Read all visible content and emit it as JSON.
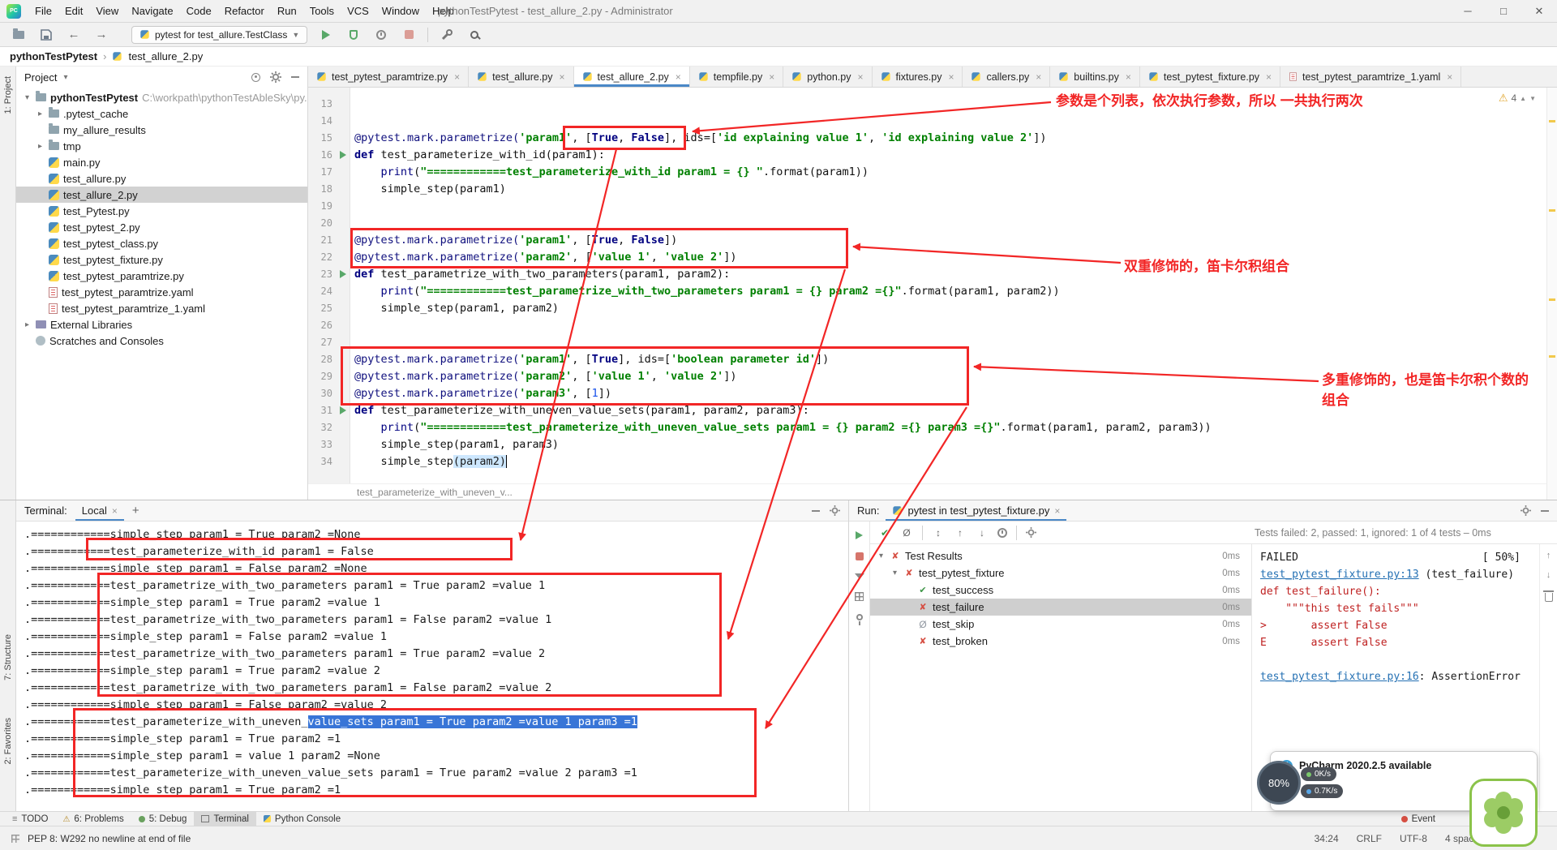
{
  "titlebar": {
    "menus": [
      "File",
      "Edit",
      "View",
      "Navigate",
      "Code",
      "Refactor",
      "Run",
      "Tools",
      "VCS",
      "Window",
      "Help"
    ],
    "title": "pythonTestPytest - test_allure_2.py - Administrator",
    "logo": "PC"
  },
  "toolbar": {
    "run_config": "pytest for test_allure.TestClass"
  },
  "breadcrumb": {
    "root": "pythonTestPytest",
    "file": "test_allure_2.py"
  },
  "stripes": {
    "project": "1: Project",
    "structure": "7: Structure",
    "favorites": "2: Favorites"
  },
  "project": {
    "header": "Project",
    "tree": [
      {
        "indent": 0,
        "chevron": "▾",
        "icon": "folder",
        "label": "pythonTestPytest",
        "path": "C:\\workpath\\pythonTestAbleSky\\py...",
        "bold": true
      },
      {
        "indent": 1,
        "chevron": "▸",
        "icon": "folder",
        "label": ".pytest_cache"
      },
      {
        "indent": 1,
        "icon": "folder",
        "label": "my_allure_results"
      },
      {
        "indent": 1,
        "chevron": "▸",
        "icon": "folder",
        "label": "tmp"
      },
      {
        "indent": 1,
        "icon": "py",
        "label": "main.py"
      },
      {
        "indent": 1,
        "icon": "py",
        "label": "test_allure.py"
      },
      {
        "indent": 1,
        "icon": "py",
        "label": "test_allure_2.py",
        "selected": true
      },
      {
        "indent": 1,
        "icon": "py",
        "label": "test_Pytest.py"
      },
      {
        "indent": 1,
        "icon": "py",
        "label": "test_pytest_2.py"
      },
      {
        "indent": 1,
        "icon": "py",
        "label": "test_pytest_class.py"
      },
      {
        "indent": 1,
        "icon": "py",
        "label": "test_pytest_fixture.py"
      },
      {
        "indent": 1,
        "icon": "py",
        "label": "test_pytest_paramtrize.py"
      },
      {
        "indent": 1,
        "icon": "yaml",
        "label": "test_pytest_paramtrize.yaml"
      },
      {
        "indent": 1,
        "icon": "yaml",
        "label": "test_pytest_paramtrize_1.yaml"
      },
      {
        "indent": 0,
        "chevron": "▸",
        "icon": "lib",
        "label": "External Libraries"
      },
      {
        "indent": 0,
        "icon": "scratch",
        "label": "Scratches and Consoles"
      }
    ]
  },
  "editor": {
    "tabs": [
      {
        "label": "test_pytest_paramtrize.py",
        "icon": "py"
      },
      {
        "label": "test_allure.py",
        "icon": "py"
      },
      {
        "label": "test_allure_2.py",
        "icon": "py",
        "active": true
      },
      {
        "label": "tempfile.py",
        "icon": "py"
      },
      {
        "label": "python.py",
        "icon": "py"
      },
      {
        "label": "fixtures.py",
        "icon": "py"
      },
      {
        "label": "callers.py",
        "icon": "py"
      },
      {
        "label": "builtins.py",
        "icon": "py"
      },
      {
        "label": "test_pytest_fixture.py",
        "icon": "py"
      },
      {
        "label": "test_pytest_paramtrize_1.yaml",
        "icon": "yaml"
      }
    ],
    "inspection": {
      "warnings": "4"
    },
    "context_hint": "test_parameterize_with_uneven_v...",
    "code": {
      "lines": [
        {
          "n": 13,
          "seg": []
        },
        {
          "n": 14,
          "seg": []
        },
        {
          "n": 15,
          "seg": [
            [
              "d",
              "@pytest.mark.parametrize("
            ],
            [
              "s",
              "'param1'"
            ],
            [
              "t",
              ", ["
            ],
            [
              "k",
              "True"
            ],
            [
              "t",
              ", "
            ],
            [
              "k",
              "False"
            ],
            [
              "t",
              "], ids=["
            ],
            [
              "s",
              "'id explaining value 1'"
            ],
            [
              "t",
              ", "
            ],
            [
              "s",
              "'id explaining value 2'"
            ],
            [
              "t",
              "])"
            ]
          ]
        },
        {
          "n": 16,
          "run": true,
          "seg": [
            [
              "k",
              "def "
            ],
            [
              "t",
              "test_parameterize_with_id(param1):"
            ]
          ]
        },
        {
          "n": 17,
          "seg": [
            [
              "t",
              "    "
            ],
            [
              "k2",
              "print"
            ],
            [
              "t",
              "("
            ],
            [
              "s",
              "\"============test_parameterize_with_id param1 = {} \""
            ],
            [
              "t",
              ".format(param1))"
            ]
          ]
        },
        {
          "n": 18,
          "seg": [
            [
              "t",
              "    simple_step(param1)"
            ]
          ]
        },
        {
          "n": 19,
          "seg": []
        },
        {
          "n": 20,
          "seg": []
        },
        {
          "n": 21,
          "seg": [
            [
              "d",
              "@pytest.mark.parametrize("
            ],
            [
              "s",
              "'param1'"
            ],
            [
              "t",
              ", ["
            ],
            [
              "k",
              "True"
            ],
            [
              "t",
              ", "
            ],
            [
              "k",
              "False"
            ],
            [
              "t",
              "])"
            ]
          ]
        },
        {
          "n": 22,
          "seg": [
            [
              "d",
              "@pytest.mark.parametrize("
            ],
            [
              "s",
              "'param2'"
            ],
            [
              "t",
              ", ["
            ],
            [
              "s",
              "'value 1'"
            ],
            [
              "t",
              ", "
            ],
            [
              "s",
              "'value 2'"
            ],
            [
              "t",
              "])"
            ]
          ]
        },
        {
          "n": 23,
          "run": true,
          "seg": [
            [
              "k",
              "def "
            ],
            [
              "t",
              "test_parametrize_with_two_parameters(param1, param2):"
            ]
          ]
        },
        {
          "n": 24,
          "seg": [
            [
              "t",
              "    "
            ],
            [
              "k2",
              "print"
            ],
            [
              "t",
              "("
            ],
            [
              "s",
              "\"============test_parametrize_with_two_parameters param1 = {} param2 ={}\""
            ],
            [
              "t",
              ".format(param1, param2))"
            ]
          ]
        },
        {
          "n": 25,
          "seg": [
            [
              "t",
              "    simple_step(param1, param2)"
            ]
          ]
        },
        {
          "n": 26,
          "seg": []
        },
        {
          "n": 27,
          "seg": []
        },
        {
          "n": 28,
          "seg": [
            [
              "d",
              "@pytest.mark.parametrize("
            ],
            [
              "s",
              "'param1'"
            ],
            [
              "t",
              ", ["
            ],
            [
              "k",
              "True"
            ],
            [
              "t",
              "], ids=["
            ],
            [
              "s",
              "'boolean parameter id'"
            ],
            [
              "t",
              "])"
            ]
          ]
        },
        {
          "n": 29,
          "seg": [
            [
              "d",
              "@pytest.mark.parametrize("
            ],
            [
              "s",
              "'param2'"
            ],
            [
              "t",
              ", ["
            ],
            [
              "s",
              "'value 1'"
            ],
            [
              "t",
              ", "
            ],
            [
              "s",
              "'value 2'"
            ],
            [
              "t",
              "])"
            ]
          ]
        },
        {
          "n": 30,
          "seg": [
            [
              "d",
              "@pytest.mark.parametrize("
            ],
            [
              "s",
              "'param3'"
            ],
            [
              "t",
              ", ["
            ],
            [
              "num",
              "1"
            ],
            [
              "t",
              "])"
            ]
          ]
        },
        {
          "n": 31,
          "run": true,
          "seg": [
            [
              "k",
              "def "
            ],
            [
              "t",
              "test_parameterize_with_uneven_value_sets(param1, param2, param3):"
            ]
          ]
        },
        {
          "n": 32,
          "seg": [
            [
              "t",
              "    "
            ],
            [
              "k2",
              "print"
            ],
            [
              "t",
              "("
            ],
            [
              "s",
              "\"============test_parameterize_with_uneven_value_sets param1 = {} param2 ={} param3 ={}\""
            ],
            [
              "t",
              ".format(param1, param2, param3))"
            ]
          ]
        },
        {
          "n": 33,
          "seg": [
            [
              "t",
              "    simple_step(param1, param3)"
            ]
          ]
        },
        {
          "n": 34,
          "caret": true,
          "seg": [
            [
              "t",
              "    simple_step"
            ],
            [
              "hl",
              "(param2)"
            ]
          ]
        }
      ]
    }
  },
  "terminal": {
    "title": "Terminal:",
    "tab": "Local",
    "lines": [
      {
        "t": ".============simple_step param1 = True param2 =None"
      },
      {
        "t": ".============test_parameterize_with_id param1 = False"
      },
      {
        "t": ".============simple_step param1 = False param2 =None"
      },
      {
        "t": ".============test_parametrize_with_two_parameters param1 = True param2 =value 1"
      },
      {
        "t": ".============simple_step param1 = True param2 =value 1"
      },
      {
        "t": ".============test_parametrize_with_two_parameters param1 = False param2 =value 1"
      },
      {
        "t": ".============simple_step param1 = False param2 =value 1"
      },
      {
        "t": ".============test_parametrize_with_two_parameters param1 = True param2 =value 2"
      },
      {
        "t": ".============simple_step param1 = True param2 =value 2"
      },
      {
        "t": ".============test_parametrize_with_two_parameters param1 = False param2 =value 2"
      },
      {
        "t": ".============simple_step param1 = False param2 =value 2"
      },
      {
        "pre": ".============test_parameterize_with_uneven_",
        "sel": "value_sets param1 = True param2 =value 1 param3 =1"
      },
      {
        "t": ".============simple_step param1 = True param2 =1"
      },
      {
        "t": ".============simple_step param1 = value 1 param2 =None"
      },
      {
        "t": ".============test_parameterize_with_uneven_value_sets param1 = True param2 =value 2 param3 =1"
      },
      {
        "t": ".============simple_step param1 = True param2 =1"
      }
    ]
  },
  "run": {
    "label": "Run:",
    "tab": "pytest in test_pytest_fixture.py",
    "stats": "Tests failed: 2, passed: 1, ignored: 1 of 4 tests – 0ms",
    "tree": [
      {
        "indent": 0,
        "chevron": "▾",
        "icon": "fail",
        "label": "Test Results",
        "time": "0ms"
      },
      {
        "indent": 1,
        "chevron": "▾",
        "icon": "fail",
        "label": "test_pytest_fixture",
        "time": "0ms"
      },
      {
        "indent": 2,
        "icon": "pass",
        "label": "test_success",
        "time": "0ms"
      },
      {
        "indent": 2,
        "icon": "fail",
        "label": "test_failure",
        "time": "0ms",
        "selected": true
      },
      {
        "indent": 2,
        "icon": "skip",
        "label": "test_skip",
        "time": "0ms"
      },
      {
        "indent": 2,
        "icon": "fail",
        "label": "test_broken",
        "time": "0ms"
      }
    ],
    "console": [
      {
        "cls": "plain",
        "t": "FAILED                             [ 50%]"
      },
      {
        "cls": "plain",
        "link": "test_pytest_fixture.py:13",
        "rest": " (test_failure)"
      },
      {
        "cls": "err",
        "t": "def test_failure():"
      },
      {
        "cls": "err",
        "t": "    \"\"\"this test fails\"\"\""
      },
      {
        "cls": "err",
        "t": ">       assert False"
      },
      {
        "cls": "err",
        "t": "E       assert False"
      },
      {
        "cls": "plain",
        "t": ""
      },
      {
        "cls": "plain",
        "link": "test_pytest_fixture.py:16",
        "rest": ": AssertionError"
      }
    ]
  },
  "annotations": {
    "note1": "参数是个列表，依次执行参数，所以 一共执行两次",
    "note2": "双重修饰的，笛卡尔积组合",
    "note3a": "多重修饰的，也是笛卡尔积个数的",
    "note3b": "组合"
  },
  "toolwindow": {
    "items": [
      {
        "label": "TODO",
        "icon": "todo"
      },
      {
        "label": "6: Problems",
        "icon": "warn"
      },
      {
        "label": "5: Debug",
        "icon": "debug"
      },
      {
        "label": "Terminal",
        "icon": "term",
        "active": true
      },
      {
        "label": "Python Console",
        "icon": "py"
      }
    ],
    "event": "Event"
  },
  "statusbar": {
    "message": "PEP 8: W292 no newline at end of file",
    "caret": "34:24",
    "line_sep": "CRLF",
    "encoding": "UTF-8",
    "indent": "4 spaces"
  },
  "notification": {
    "title": "PyCharm 2020.2.5 available"
  },
  "net": {
    "pct": "80%",
    "up": "0K/s",
    "down": "0.7K/s"
  }
}
